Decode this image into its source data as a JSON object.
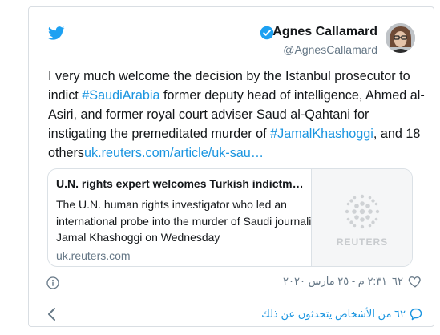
{
  "tweet": {
    "author": {
      "name": "Agnes Callamard",
      "handle": "@AgnesCallamard",
      "avatar": "avatar-photo"
    },
    "text": {
      "p1": "I very much welcome the decision by the Istanbul prosecutor to indict ",
      "hashtag1": "#SaudiArabia",
      "p2": " former deputy head of intelligence, Ahmed al-Asiri, and former royal court adviser Saud al-Qahtani for instigating the premeditated murder of ",
      "hashtag2": "#JamalKhashoggi",
      "p3": ", and 18 others",
      "url": "uk.reuters.com/article/uk-sau…"
    },
    "link_card": {
      "title": "U.N. rights expert welcomes Turkish indictm…",
      "description": "The U.N. human rights investigator who led an international probe into the murder of Saudi journalist Jamal Khashoggi on Wednesday",
      "domain": "uk.reuters.com",
      "thumbnail_label": "REUTERS"
    },
    "likes": "٦٢",
    "timestamp": "٢:٣١ م - ٢٥ مارس ٢٠٢٠",
    "people_talking": "٦٢ من الأشخاص يتحدثون عن ذلك"
  },
  "icons": {
    "brand": "twitter-bird-icon",
    "verified": "verified-badge-icon",
    "info": "info-icon",
    "like": "heart-icon",
    "comment": "comment-icon",
    "back": "chevron-left-icon"
  },
  "colors": {
    "link": "#1b95e0",
    "text": "#14171a",
    "muted": "#657786",
    "border": "#d9dee3"
  }
}
